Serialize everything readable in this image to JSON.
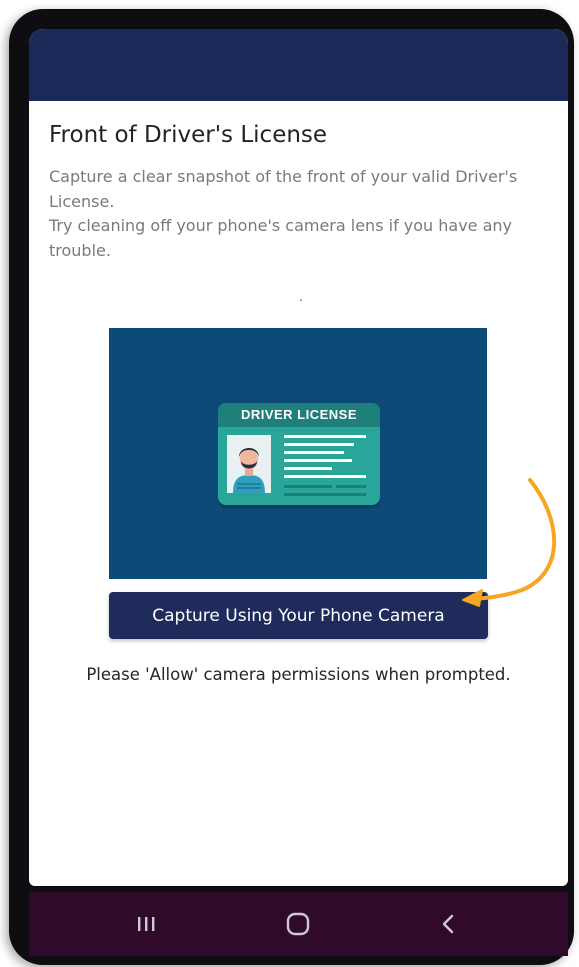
{
  "page": {
    "title": "Front of Driver's License",
    "instructions": [
      "Capture a clear snapshot of the front of your valid Driver's License.",
      "Try cleaning off your phone's camera lens if you have any trouble."
    ],
    "stray_dot": "."
  },
  "license_illustration": {
    "card_heading": "DRIVER LICENSE"
  },
  "capture_button": {
    "label": "Capture Using Your Phone Camera"
  },
  "permission_note": "Please 'Allow' camera permissions when prompted.",
  "system_nav": {
    "recent_icon": "recent-apps-icon",
    "home_icon": "home-icon",
    "back_icon": "back-icon"
  },
  "colors": {
    "header": "#1c2a5a",
    "button": "#1f2b5b",
    "panel": "#0e4a78",
    "card": "#2aa59a",
    "arrow": "#f5a623",
    "nav_bar": "#300a2b"
  }
}
